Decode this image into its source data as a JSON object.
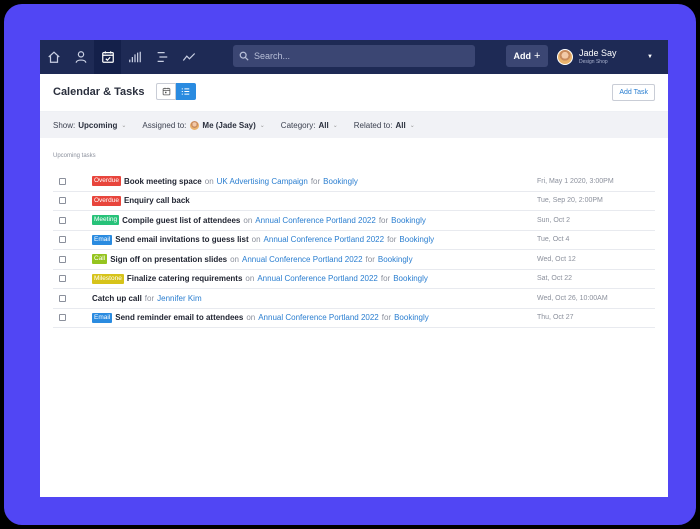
{
  "nav": {
    "search_placeholder": "Search...",
    "add_label": "Add",
    "user_name": "Jade Say",
    "user_company": "Design Shop"
  },
  "header": {
    "title": "Calendar & Tasks",
    "add_task_label": "Add Task"
  },
  "filters": {
    "show_label": "Show:",
    "show_value": "Upcoming",
    "assigned_label": "Assigned to:",
    "assigned_value": "Me (Jade Say)",
    "category_label": "Category:",
    "category_value": "All",
    "related_label": "Related to:",
    "related_value": "All"
  },
  "section_label": "Upcoming tasks",
  "colors": {
    "Overdue": "#e8453c",
    "Meeting": "#27c279",
    "Email": "#2a8be0",
    "Call": "#95c41f",
    "Milestone": "#d6c31a"
  },
  "tasks": [
    {
      "badge": "Overdue",
      "title": "Book meeting space",
      "on": "on",
      "campaign": "UK Advertising Campaign",
      "for": "for",
      "client": "Bookingly",
      "date": "Fri, May 1 2020, 3:00PM"
    },
    {
      "badge": "Overdue",
      "title": "Enquiry call back",
      "on": "",
      "campaign": "",
      "for": "",
      "client": "",
      "date": "Tue, Sep 20, 2:00PM"
    },
    {
      "badge": "Meeting",
      "title": "Compile guest list of attendees",
      "on": "on",
      "campaign": "Annual Conference Portland 2022",
      "for": "for",
      "client": "Bookingly",
      "date": "Sun, Oct 2"
    },
    {
      "badge": "Email",
      "title": "Send email invitations to guess list",
      "on": "on",
      "campaign": "Annual Conference Portland 2022",
      "for": "for",
      "client": "Bookingly",
      "date": "Tue, Oct 4"
    },
    {
      "badge": "Call",
      "title": "Sign off on presentation slides",
      "on": "on",
      "campaign": "Annual Conference Portland 2022",
      "for": "for",
      "client": "Bookingly",
      "date": "Wed, Oct 12"
    },
    {
      "badge": "Milestone",
      "title": "Finalize catering requirements",
      "on": "on",
      "campaign": "Annual Conference Portland 2022",
      "for": "for",
      "client": "Bookingly",
      "date": "Sat, Oct 22"
    },
    {
      "badge": "",
      "title": "Catch up call",
      "on": "",
      "campaign": "",
      "for": "for",
      "client": "Jennifer Kim",
      "date": "Wed, Oct 26, 10:00AM"
    },
    {
      "badge": "Email",
      "title": "Send reminder email to attendees",
      "on": "on",
      "campaign": "Annual Conference Portland 2022",
      "for": "for",
      "client": "Bookingly",
      "date": "Thu, Oct 27"
    }
  ]
}
